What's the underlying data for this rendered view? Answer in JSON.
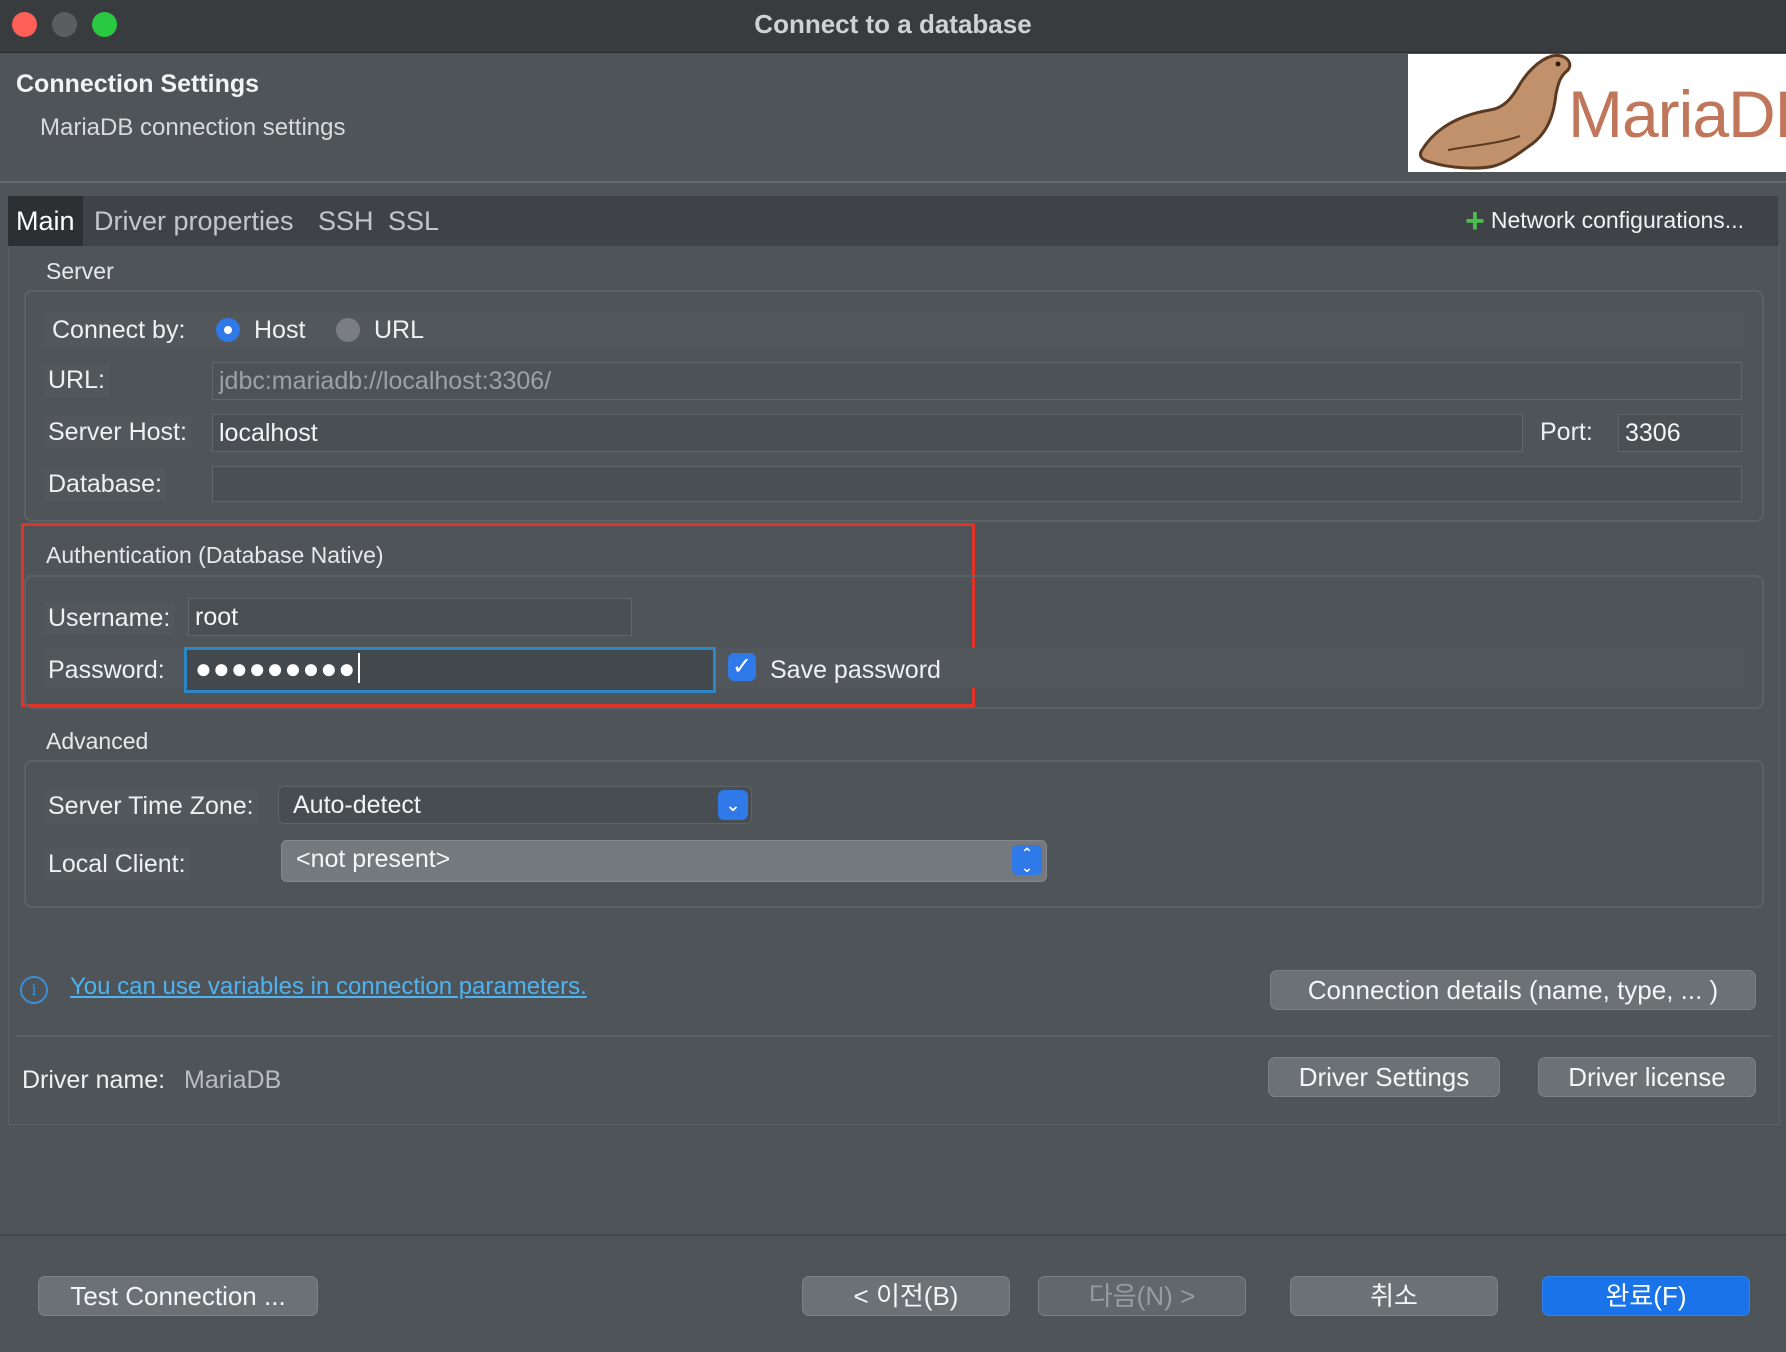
{
  "window": {
    "title": "Connect to a database"
  },
  "header": {
    "title": "Connection Settings",
    "subtitle": "MariaDB connection settings",
    "logo_text": "MariaDB"
  },
  "tabs": [
    {
      "label": "Main",
      "active": true
    },
    {
      "label": "Driver properties",
      "active": false
    },
    {
      "label": "SSH",
      "active": false
    },
    {
      "label": "SSL",
      "active": false
    }
  ],
  "network_config": {
    "label": "Network configurations..."
  },
  "server": {
    "section_label": "Server",
    "connect_by_label": "Connect by:",
    "connect_by_options": [
      {
        "label": "Host",
        "selected": true
      },
      {
        "label": "URL",
        "selected": false
      }
    ],
    "url_label": "URL:",
    "url_value": "jdbc:mariadb://localhost:3306/",
    "host_label": "Server Host:",
    "host_value": "localhost",
    "port_label": "Port:",
    "port_value": "3306",
    "database_label": "Database:",
    "database_value": ""
  },
  "auth": {
    "section_label": "Authentication (Database Native)",
    "username_label": "Username:",
    "username_value": "root",
    "password_label": "Password:",
    "password_value": "●●●●●●●●●",
    "save_password_label": "Save password",
    "save_password_checked": true
  },
  "advanced": {
    "section_label": "Advanced",
    "timezone_label": "Server Time Zone:",
    "timezone_value": "Auto-detect",
    "local_client_label": "Local Client:",
    "local_client_value": "<not present>"
  },
  "info": {
    "link_text": "You can use variables in connection parameters.",
    "connection_details_button": "Connection details (name, type, ... )"
  },
  "driver": {
    "name_label": "Driver name:",
    "name_value": "MariaDB",
    "settings_button": "Driver Settings",
    "license_button": "Driver license"
  },
  "footer": {
    "test_connection": "Test Connection ...",
    "back": "< 이전(B)",
    "next": "다음(N) >",
    "cancel": "취소",
    "finish": "완료(F)"
  },
  "colors": {
    "accent": "#1a73e8",
    "highlight_border": "#e4322b",
    "link": "#4db3f2"
  }
}
